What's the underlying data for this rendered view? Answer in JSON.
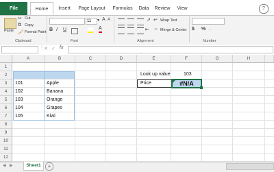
{
  "ribbon_tabs": [
    "File",
    "Home",
    "Insert",
    "Page Layout",
    "Formulas",
    "Data",
    "Review",
    "View"
  ],
  "clipboard": {
    "paste": "Paste",
    "cut": "Cut",
    "copy": "Copy",
    "format_painter": "Format Paint",
    "label": "Clipboard"
  },
  "font": {
    "size": "11",
    "bold": "B",
    "italic": "I",
    "underline": "U",
    "grow": "A",
    "shrink": "A",
    "font_color": "A",
    "label": "Font"
  },
  "alignment": {
    "wrap_text": "Wrap Text",
    "merge_center": "Merge & Center",
    "label": "Alignment"
  },
  "number": {
    "currency": "$",
    "percent": "%",
    "label": "Number"
  },
  "formula_bar": {
    "fx": "fx"
  },
  "columns": [
    "A",
    "B",
    "C",
    "D",
    "E",
    "F",
    "G",
    "H"
  ],
  "rows": [
    "1",
    "2",
    "3",
    "4",
    "5",
    "6",
    "7",
    "8",
    "9",
    "10",
    "11",
    "12"
  ],
  "table": {
    "rows": [
      {
        "a": "101",
        "b": "Apple"
      },
      {
        "a": "102",
        "b": "Banana"
      },
      {
        "a": "103",
        "b": "Orange"
      },
      {
        "a": "104",
        "b": "Grapes"
      },
      {
        "a": "105",
        "b": "Kiwi"
      }
    ]
  },
  "lookup": {
    "label": "Look up value",
    "value": "103",
    "price_label": "Price",
    "result": "#N/A"
  },
  "sheet_tab": "Sheet1",
  "colors": {
    "accent": "#217346",
    "header_fill": "#bdd7ee",
    "result_fill": "#bdd7ee"
  }
}
